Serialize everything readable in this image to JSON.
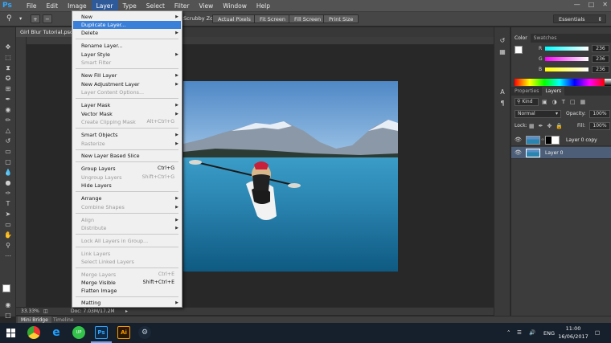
{
  "app": {
    "logo": "Ps",
    "menus": [
      "File",
      "Edit",
      "Image",
      "Layer",
      "Type",
      "Select",
      "Filter",
      "View",
      "Window",
      "Help"
    ],
    "active_menu": "Layer",
    "window_controls": [
      "minimize-icon",
      "maximize-icon",
      "close-icon"
    ]
  },
  "options_bar": {
    "scrubby_zoom": "Scrubby Zoom",
    "actual_pixels": "Actual Pixels",
    "fit_screen": "Fit Screen",
    "fill_screen": "Fill Screen",
    "print_size": "Print Size",
    "workspace": "Essentials"
  },
  "document": {
    "tab_title": "Girl Blur Tutorial.psd",
    "zoom": "33.33%",
    "doc_size": "Doc: 7.03M/17.2M"
  },
  "bottom_tabs": [
    "Mini Bridge",
    "Timeline"
  ],
  "color_panel": {
    "tabs": [
      "Color",
      "Swatches"
    ],
    "r_label": "R",
    "g_label": "G",
    "b_label": "B",
    "r": "236",
    "g": "236",
    "b": "236"
  },
  "layers_panel": {
    "tabs": [
      "Properties",
      "Layers"
    ],
    "kind": "Kind",
    "blend_mode": "Normal",
    "opacity_label": "Opacity:",
    "opacity": "100%",
    "lock_label": "Lock:",
    "fill_label": "Fill:",
    "fill": "100%",
    "layers": [
      {
        "name": "Layer 0 copy",
        "selected": false
      },
      {
        "name": "Layer 0",
        "selected": true
      }
    ]
  },
  "layer_menu": {
    "new": "New",
    "duplicate": "Duplicate Layer...",
    "delete": "Delete",
    "rename": "Rename Layer...",
    "layer_style": "Layer Style",
    "smart_filter": "Smart Filter",
    "new_fill": "New Fill Layer",
    "new_adjustment": "New Adjustment Layer",
    "content_options": "Layer Content Options...",
    "layer_mask": "Layer Mask",
    "vector_mask": "Vector Mask",
    "clipping_mask": "Create Clipping Mask",
    "clipping_sc": "Alt+Ctrl+G",
    "smart_objects": "Smart Objects",
    "rasterize": "Rasterize",
    "slice": "New Layer Based Slice",
    "group": "Group Layers",
    "group_sc": "Ctrl+G",
    "ungroup": "Ungroup Layers",
    "ungroup_sc": "Shift+Ctrl+G",
    "hide": "Hide Layers",
    "arrange": "Arrange",
    "combine": "Combine Shapes",
    "align": "Align",
    "distribute": "Distribute",
    "lock_all": "Lock All Layers in Group...",
    "link": "Link Layers",
    "select_linked": "Select Linked Layers",
    "merge": "Merge Layers",
    "merge_sc": "Ctrl+E",
    "merge_visible": "Merge Visible",
    "merge_visible_sc": "Shift+Ctrl+E",
    "flatten": "Flatten Image",
    "matting": "Matting"
  },
  "taskbar": {
    "language": "ENG",
    "time": "11:00",
    "date": "16/06/2017"
  },
  "colors": {
    "menu_highlight": "#3a80d8",
    "ps_blue": "#31a8ff",
    "foreground_swatch": "#ffffff",
    "background_swatch": "#e00000"
  }
}
